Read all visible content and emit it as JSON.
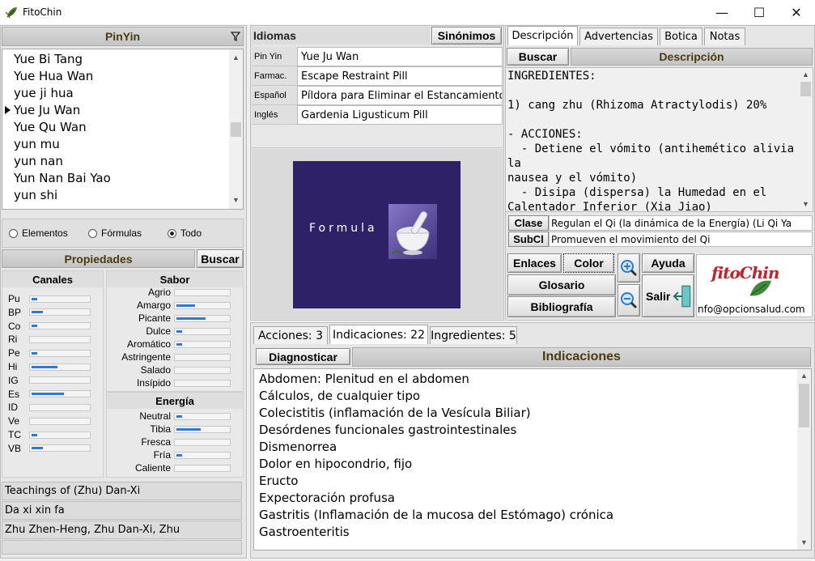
{
  "window": {
    "title": "FitoChin",
    "minimize": "—",
    "maximize": "☐",
    "close": "✕"
  },
  "left": {
    "header": "PinYin",
    "filter_icon": "filter-icon",
    "formula_list": [
      "Yue Bi Tang",
      "Yue Hua Wan",
      "yue ji hua",
      "Yue Ju Wan",
      "Yue Qu Wan",
      "yun mu",
      "yun nan",
      "Yun Nan Bai Yao",
      "yun shi"
    ],
    "selected_index": 3,
    "filter_options": {
      "elementos": "Elementos",
      "formulas": "Fórmulas",
      "todo": "Todo",
      "selected": "Todo"
    },
    "propiedades": {
      "title": "Propiedades",
      "buscar": "Buscar"
    },
    "canales": {
      "title": "Canales",
      "rows": [
        {
          "label": "Pu",
          "value": 0.1
        },
        {
          "label": "BP",
          "value": 0.2
        },
        {
          "label": "Co",
          "value": 0.1
        },
        {
          "label": "Ri",
          "value": 0
        },
        {
          "label": "Pe",
          "value": 0.1
        },
        {
          "label": "Hi",
          "value": 0.45
        },
        {
          "label": "IG",
          "value": 0
        },
        {
          "label": "Es",
          "value": 0.55
        },
        {
          "label": "ID",
          "value": 0
        },
        {
          "label": "Ve",
          "value": 0
        },
        {
          "label": "TC",
          "value": 0.1
        },
        {
          "label": "VB",
          "value": 0.2
        }
      ]
    },
    "sabor": {
      "title": "Sabor",
      "rows": [
        {
          "label": "Agrio",
          "value": 0
        },
        {
          "label": "Amargo",
          "value": 0.35
        },
        {
          "label": "Picante",
          "value": 0.55
        },
        {
          "label": "Dulce",
          "value": 0.1
        },
        {
          "label": "Aromático",
          "value": 0.1
        },
        {
          "label": "Astringente",
          "value": 0
        },
        {
          "label": "Salado",
          "value": 0
        },
        {
          "label": "Insípido",
          "value": 0
        }
      ]
    },
    "energia": {
      "title": "Energía",
      "rows": [
        {
          "label": "Neutral",
          "value": 0.1
        },
        {
          "label": "Tibia",
          "value": 0.45
        },
        {
          "label": "Fresca",
          "value": 0
        },
        {
          "label": "Fría",
          "value": 0.1
        },
        {
          "label": "Caliente",
          "value": 0
        }
      ]
    },
    "sources": [
      "Teachings of (Zhu) Dan-Xi",
      "Da xi xin fa",
      "Zhu Zhen-Heng, Zhu Dan-Xi, Zhu"
    ]
  },
  "middle": {
    "idiomas": "Idiomas",
    "sinonimos": "Sinónimos",
    "fields": [
      {
        "label": "Pin Yin",
        "value": "Yue Ju Wan"
      },
      {
        "label": "Farmac.",
        "value": "Escape Restraint Pill"
      },
      {
        "label": "Español",
        "value": "Píldora para Eliminar el Estancamiento"
      },
      {
        "label": "Inglés",
        "value": "Gardenia Ligusticum Pill"
      }
    ],
    "image_caption": "Formula"
  },
  "right": {
    "tabs": [
      "Descripción",
      "Advertencias",
      "Botica",
      "Notas"
    ],
    "active_tab": "Descripción",
    "buscar": "Buscar",
    "desc_header": "Descripción",
    "description": "INGREDIENTES:\n\n1) cang zhu (Rhizoma Atractylodis) 20%\n\n- ACCIONES:\n  - Detiene el vómito (antihemético alivia la\nnausea y el vómito)\n  - Disipa (dispersa) la Humedad en el\nCalentador Inferior (Xia Jiao)\n  - Disipa la Humedad (dispersa, controla,",
    "clase": {
      "key": "Clase",
      "value": "Regulan el Qi (la dinámica de la Energía) (Li Qi Ya"
    },
    "subcl": {
      "key": "SubCl",
      "value": "Promueven el movimiento del Qi"
    },
    "buttons": {
      "enlaces": "Enlaces",
      "color": "Color",
      "glosario": "Glosario",
      "bibliografia": "Bibliografía",
      "ayuda": "Ayuda",
      "salir": "Salir"
    },
    "logo": {
      "text": "fitoChin",
      "email": "nfo@opcionsalud.com"
    }
  },
  "bottom": {
    "tabs": [
      "Acciones: 3",
      "Indicaciones: 22",
      "Ingredientes: 5"
    ],
    "active_tab": "Indicaciones: 22",
    "diagnosticar": "Diagnosticar",
    "header": "Indicaciones",
    "items": [
      "Abdomen: Plenitud en el abdomen",
      "Cálculos, de cualquier tipo",
      "Colecistitis (inflamación de la Vesícula Biliar)",
      "Desórdenes funcionales gastrointestinales",
      "Dismenorrea",
      "Dolor en hipocondrio, fijo",
      "Eructo",
      "Expectoración profusa",
      "Gastritis (Inflamación de la mucosa del Estómago) crónica",
      "Gastroenteritis"
    ]
  },
  "colors": {
    "accent_blue": "#2d7bd0",
    "image_bg": "#2e2168",
    "logo_red": "#c0242a"
  }
}
